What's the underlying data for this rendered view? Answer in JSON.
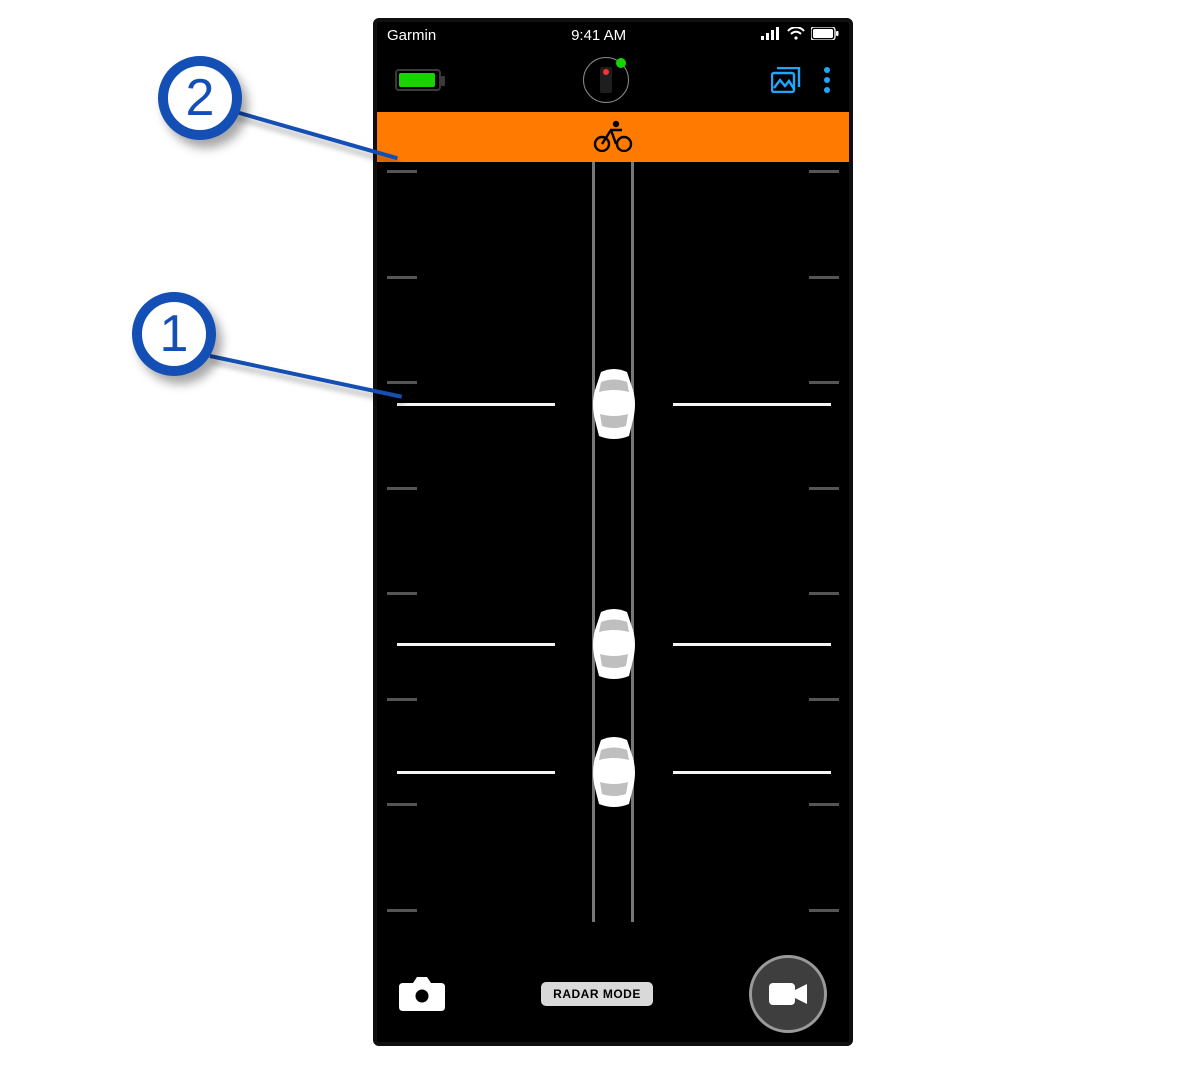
{
  "status": {
    "carrier": "Garmin",
    "time": "9:41 AM"
  },
  "toolbar": {
    "battery_percent": 85,
    "gallery_icon": "gallery-icon",
    "more_icon": "more-vertical-icon",
    "sensor_connected": true
  },
  "banner": {
    "icon": "cyclist-icon",
    "color": "#ff7a00"
  },
  "radar": {
    "vehicles": [
      {
        "distance_fraction": 0.28
      },
      {
        "distance_fraction": 0.58
      },
      {
        "distance_fraction": 0.74
      }
    ],
    "tick_count_per_side": 8
  },
  "bottom": {
    "photo_icon": "camera-icon",
    "mode_label": "RADAR MODE",
    "video_icon": "video-camera-icon"
  },
  "callouts": {
    "c1": "1",
    "c2": "2"
  }
}
